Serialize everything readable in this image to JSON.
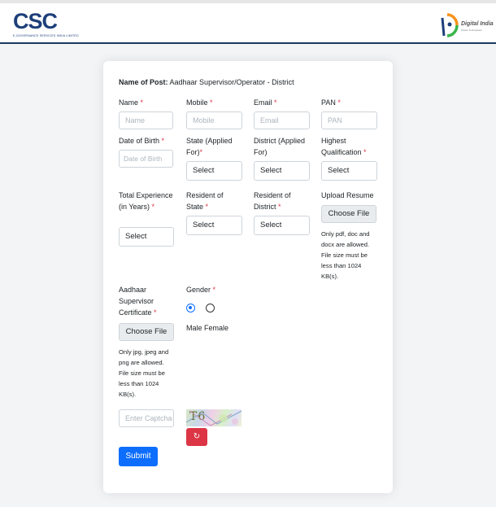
{
  "header": {
    "csc_logo_text": "CSC",
    "csc_tagline": "E-GOVERNANCE SERVICES INDIA LIMITED",
    "digital_india_title": "Digital India",
    "digital_india_tagline": "Power To Empower"
  },
  "form": {
    "post_label": "Name of Post:",
    "post_value": "Aadhaar Supervisor/Operator - District",
    "required_mark": "*",
    "fields": {
      "name": {
        "label": "Name",
        "placeholder": "Name"
      },
      "mobile": {
        "label": "Mobile",
        "placeholder": "Mobile"
      },
      "email": {
        "label": "Email",
        "placeholder": "Email"
      },
      "pan": {
        "label": "PAN",
        "placeholder": "PAN"
      },
      "dob": {
        "label": "Date of Birth",
        "placeholder": "Date of Birth"
      },
      "state": {
        "label": "State (Applied For)",
        "value": "Select"
      },
      "district": {
        "label": "District (Applied For)",
        "value": "Select"
      },
      "qualification": {
        "label": "Highest Qualification",
        "value": "Select"
      },
      "experience": {
        "label": "Total Experience (in Years)",
        "value": "Select"
      },
      "resident_state": {
        "label": "Resident of State",
        "value": "Select"
      },
      "resident_district": {
        "label": "Resident of District",
        "value": "Select"
      },
      "resume": {
        "label": "Upload Resume",
        "button": "Choose File",
        "help": "Only pdf, doc and docx are allowed. File size must be less than 1024 KB(s)."
      },
      "certificate": {
        "label": "Aadhaar Supervisor Certificate",
        "button": "Choose File",
        "help": "Only jpg, jpeg and png are allowed. File size must be less than 1024 KB(s)."
      },
      "gender": {
        "label": "Gender",
        "options": [
          "Male",
          "Female"
        ],
        "selected": "Male"
      },
      "captcha": {
        "placeholder": "Enter Captcha",
        "image_text": "T6"
      }
    },
    "submit_label": "Submit"
  },
  "colors": {
    "primary": "#0d6efd",
    "danger": "#dc3545",
    "brand": "#1d3f7a"
  }
}
